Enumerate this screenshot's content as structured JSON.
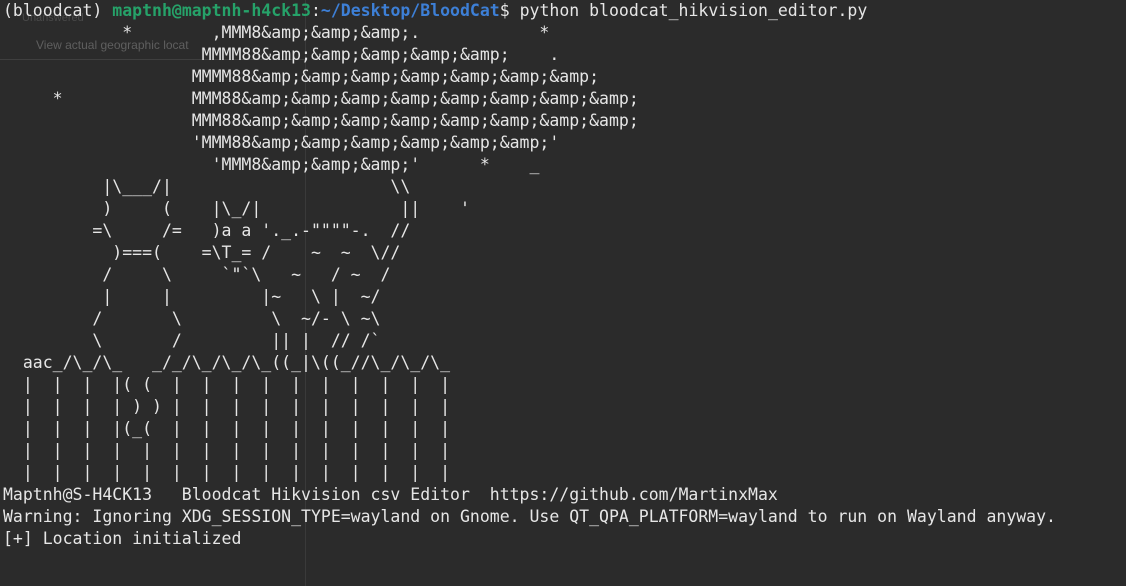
{
  "background_window": {
    "caption": "View actual geographic locat",
    "sub": "Unanswered"
  },
  "prompt": {
    "venv": "(bloodcat)",
    "user_host": "maptnh@maptnh-h4ck13",
    "colon": ":",
    "path": "~/Desktop/BloodCat",
    "symbol": "$",
    "command": "python bloodcat_hikvision_editor.py"
  },
  "ascii_art": [
    "            *        ,MMM8&amp;&amp;&amp;.            *",
    "                    MMMM88&amp;&amp;&amp;&amp;&amp;    .",
    "                   MMMM88&amp;&amp;&amp;&amp;&amp;&amp;&amp;",
    "     *             MMM88&amp;&amp;&amp;&amp;&amp;&amp;&amp;&amp;",
    "                   MMM88&amp;&amp;&amp;&amp;&amp;&amp;&amp;&amp;",
    "                   'MMM88&amp;&amp;&amp;&amp;&amp;&amp;'",
    "                     'MMM8&amp;&amp;&amp;'      *    _",
    "          |\\___/|                      \\\\",
    "          )     (    |\\_/|              ||    '",
    "         =\\     /=   )a a '._.-\"\"\"\"-.  //",
    "           )===(    =\\T_= /    ~  ~  \\//",
    "          /     \\     `\"`\\   ~   / ~  /",
    "          |     |         |~   \\ |  ~/",
    "         /       \\         \\  ~/- \\ ~\\",
    "         \\       /         || |  // /`",
    "  aac_/\\_/\\_   _/_/\\_/\\_/\\_((_|\\((_//\\_/\\_/\\_",
    "  |  |  |  |( (  |  |  |  |  |  |  |  |  |  |",
    "  |  |  |  | ) ) |  |  |  |  |  |  |  |  |  |",
    "  |  |  |  |(_(  |  |  |  |  |  |  |  |  |  |",
    "  |  |  |  |  |  |  |  |  |  |  |  |  |  |  |",
    "  |  |  |  |  |  |  |  |  |  |  |  |  |  |  |"
  ],
  "output": {
    "banner": "Maptnh@S-H4CK13   Bloodcat Hikvision csv Editor  https://github.com/MartinxMax",
    "warning": "Warning: Ignoring XDG_SESSION_TYPE=wayland on Gnome. Use QT_QPA_PLATFORM=wayland to run on Wayland anyway.",
    "status": "[+] Location initialized"
  }
}
